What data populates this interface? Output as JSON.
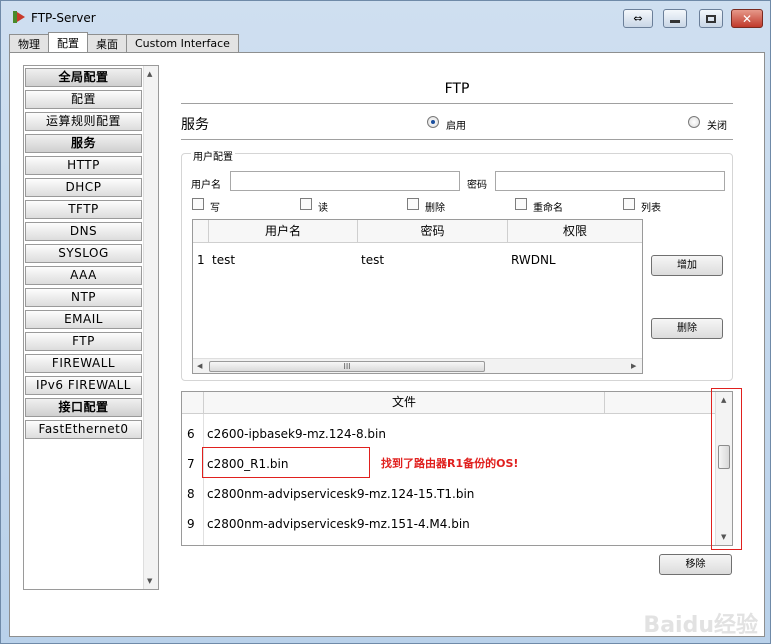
{
  "window": {
    "title": "FTP-Server"
  },
  "tabs": [
    "物理",
    "配置",
    "桌面",
    "Custom Interface"
  ],
  "active_tab": "配置",
  "sidebar": {
    "items": [
      {
        "label": "全局配置",
        "header": true
      },
      {
        "label": "配置",
        "header": false
      },
      {
        "label": "运算规则配置",
        "header": false
      },
      {
        "label": "服务",
        "header": true
      },
      {
        "label": "HTTP",
        "header": false
      },
      {
        "label": "DHCP",
        "header": false
      },
      {
        "label": "TFTP",
        "header": false
      },
      {
        "label": "DNS",
        "header": false
      },
      {
        "label": "SYSLOG",
        "header": false
      },
      {
        "label": "AAA",
        "header": false
      },
      {
        "label": "NTP",
        "header": false
      },
      {
        "label": "EMAIL",
        "header": false
      },
      {
        "label": "FTP",
        "header": false
      },
      {
        "label": "FIREWALL",
        "header": false
      },
      {
        "label": "IPv6 FIREWALL",
        "header": false
      },
      {
        "label": "接口配置",
        "header": true
      },
      {
        "label": "FastEthernet0",
        "header": false
      }
    ]
  },
  "ftp": {
    "title": "FTP",
    "service_label": "服务",
    "on_label": "启用",
    "off_label": "关闭",
    "service_state": "on"
  },
  "user_config": {
    "legend": "用户配置",
    "username_label": "用户名",
    "username_value": "",
    "password_label": "密码",
    "password_value": "",
    "permissions": [
      "写",
      "读",
      "删除",
      "重命名",
      "列表"
    ],
    "columns": [
      "用户名",
      "密码",
      "权限"
    ],
    "rows": [
      {
        "index": "1",
        "user": "test",
        "password": "test",
        "perm": "RWDNL"
      }
    ],
    "add_button": "增加",
    "delete_button": "删除",
    "hscroll_grip": "III"
  },
  "files": {
    "column": "文件",
    "rows": [
      {
        "index": "6",
        "name": "c2600-ipbasek9-mz.124-8.bin"
      },
      {
        "index": "7",
        "name": "c2800_R1.bin"
      },
      {
        "index": "8",
        "name": "c2800nm-advipservicesk9-mz.124-15.T1.bin"
      },
      {
        "index": "9",
        "name": "c2800nm-advipservicesk9-mz.151-4.M4.bin"
      }
    ],
    "remove_button": "移除"
  },
  "annotation": "找到了路由器R1备份的OS!",
  "watermark": "Baidu经验",
  "colors": {
    "annotation_red": "#e0201e",
    "radio_dot": "#1b4f9e"
  }
}
